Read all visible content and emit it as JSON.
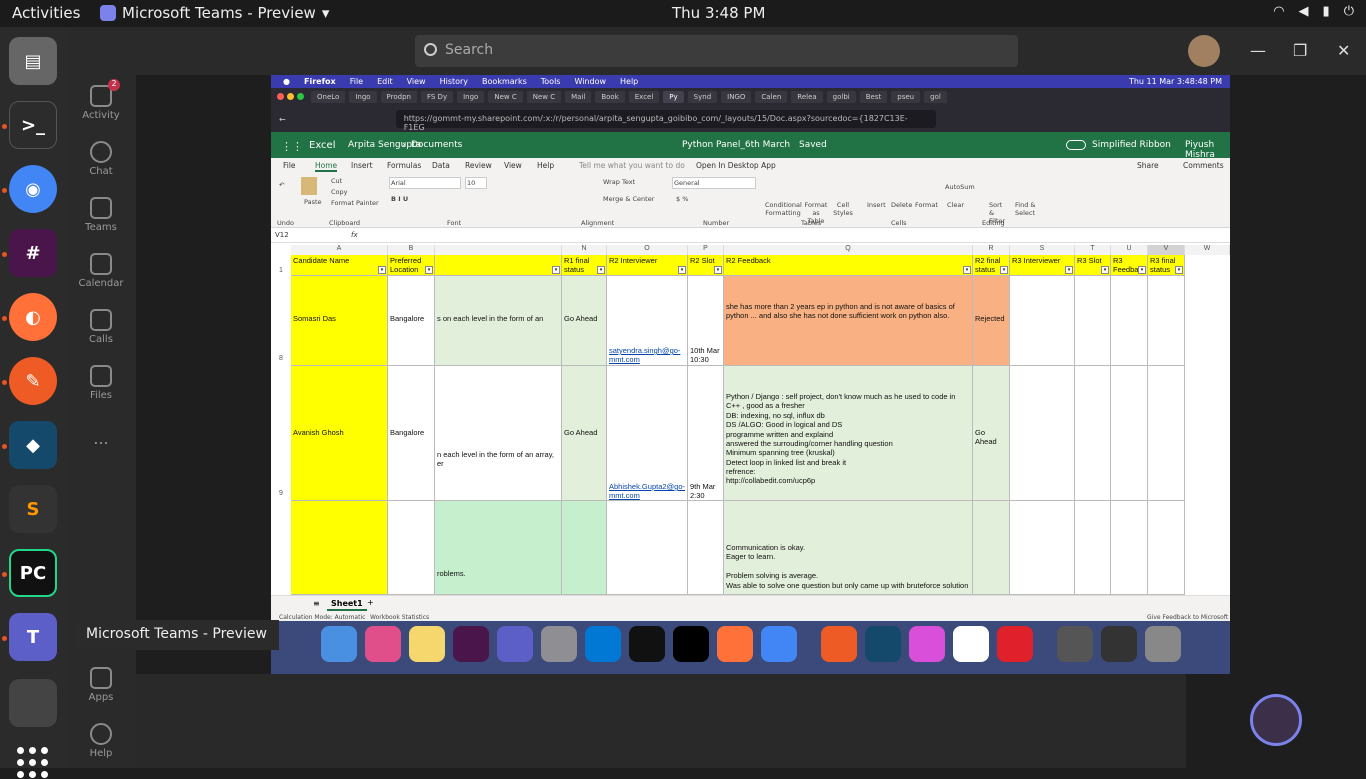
{
  "topbar": {
    "activities": "Activities",
    "app_name": "Microsoft Teams - Preview",
    "clock": "Thu  3:48 PM"
  },
  "teams": {
    "search_placeholder": "Search",
    "rail": [
      {
        "label": "Activity",
        "badge": "2"
      },
      {
        "label": "Chat"
      },
      {
        "label": "Teams"
      },
      {
        "label": "Calendar"
      },
      {
        "label": "Calls"
      },
      {
        "label": "Files"
      },
      {
        "label": "..."
      },
      {
        "label": "Apps"
      },
      {
        "label": "Help"
      }
    ],
    "tooltip": "Microsoft Teams - Preview"
  },
  "mac": {
    "menu": [
      "Firefox",
      "File",
      "Edit",
      "View",
      "History",
      "Bookmarks",
      "Tools",
      "Window",
      "Help"
    ],
    "menu_clock": "Thu 11 Mar  3:48:48 PM",
    "tabs": [
      "OneLo",
      "Ingo",
      "Prodpn",
      "FS Dy",
      "Ingo",
      "New C",
      "New C",
      "Mail",
      "Book",
      "Excel",
      "Py",
      "Synd",
      "INGO",
      "Calen",
      "Relea",
      "golbi",
      "Best",
      "pseu",
      "gol"
    ],
    "url": "https://gommt-my.sharepoint.com/:x:/r/personal/arpita_sengupta_goibibo_com/_layouts/15/Doc.aspx?sourcedoc={1827C13E-F1EG"
  },
  "excel": {
    "app": "Excel",
    "breadcrumb": [
      "Arpita Sengupta",
      "Documents"
    ],
    "doc_title": "Python Panel_6th March",
    "saved": "Saved",
    "simplified_ribbon": "Simplified Ribbon",
    "user": "Piyush Mishra",
    "menu": [
      "File",
      "Home",
      "Insert",
      "Formulas",
      "Data",
      "Review",
      "View",
      "Help"
    ],
    "tell_me": "Tell me what you want to do",
    "open_desktop": "Open In Desktop App",
    "share": "Share",
    "comments": "Comments",
    "ribbon": {
      "cut": "Cut",
      "copy": "Copy",
      "format_painter": "Format Painter",
      "paste": "Paste",
      "font": "Arial",
      "size": "10",
      "wrap": "Wrap Text",
      "merge": "Merge & Center",
      "number_format": "General",
      "autosum": "AutoSum",
      "clear": "Clear",
      "groups": [
        "Undo",
        "Clipboard",
        "Font",
        "Alignment",
        "Number",
        "Tables",
        "Cells",
        "Editing"
      ],
      "cond": "Conditional Formatting",
      "fmt_table": "Format as Table",
      "cell_styles": "Cell Styles",
      "insert": "Insert",
      "delete": "Delete",
      "format": "Format",
      "sort": "Sort & Filter",
      "find": "Find & Select"
    },
    "name_box": "V12",
    "fx": "fx",
    "columns": [
      "A",
      "B",
      "N",
      "O",
      "P",
      "Q",
      "R",
      "S",
      "T",
      "U",
      "V",
      "W"
    ],
    "headers": {
      "A": "Candidate Name",
      "B": "Preferred Location",
      "N": "R1 final status",
      "O": "R2 Interviewer",
      "P": "R2 Slot",
      "Q": "R2 Feedback",
      "R": "R2 final status",
      "S": "R3 Interviewer",
      "T": "R3 Slot",
      "U": "R3 Feedbac",
      "V": "R3 final status"
    },
    "rows": [
      {
        "num": "8",
        "A": "Somasri Das",
        "B": "Bangalore",
        "M": "s on each level in the form of an",
        "N": "Go Ahead",
        "O": "satyendra.singh@go-mmt.com",
        "P": "10th Mar 10:30",
        "Q": "she has more than 2 years ep in python and is not aware of basics of python ... and also she has not done sufficient work on python also.",
        "R": "Rejected"
      },
      {
        "num": "9",
        "A": "Avanish Ghosh",
        "B": "Bangalore",
        "M": "n each level in the form of an array, er",
        "N": "Go Ahead",
        "O": "Abhishek.Gupta2@go-mmt.com",
        "P": "9th Mar 2:30",
        "Q": "Python / Django : self project, don't know much as he used to code in C++ , good as a fresher\nDB: indexing, no sql, influx db\nDS /ALGO: Good in logical and DS\nprogramme written and explaind\nanswered the surrouding/corner handling question\nMinimum spanning tree (kruskal)\nDetect loop in linked list and break it\nrefrence:\nhttp://collabedit.com/ucp6p",
        "R": "Go Ahead"
      },
      {
        "num": "",
        "A": "",
        "B": "",
        "M": "roblems.",
        "N": "",
        "O": "",
        "P": "",
        "Q": "Communication is okay.\nEager to learn.\n\nProblem solving is average.\nWas able to solve one question but only came up with bruteforce solution",
        "R": ""
      }
    ],
    "sheet_tab": "Sheet1",
    "status_left": "Calculation Mode: Automatic",
    "status_mid": "Workbook Statistics",
    "feedback": "Give Feedback to Microsoft"
  },
  "colors": {
    "excel_green": "#217346",
    "yellow": "#ffff00",
    "orange": "#f9b183",
    "light_green": "#e2efda",
    "mint": "#c6efce"
  }
}
